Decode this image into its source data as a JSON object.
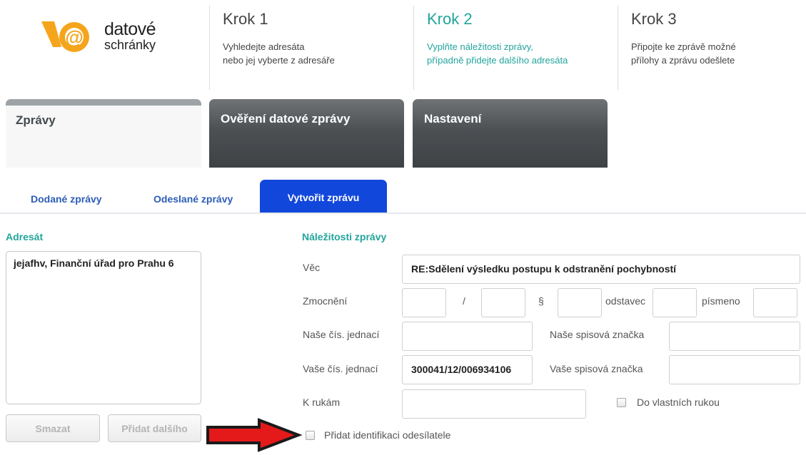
{
  "logo": {
    "line1": "datové",
    "line2": "schránky"
  },
  "steps": [
    {
      "title": "Krok 1",
      "line1": "Vyhledejte adresáta",
      "line2": "nebo jej vyberte z adresáře"
    },
    {
      "title": "Krok 2",
      "line1": "Vyplňte náležitosti zprávy,",
      "line2": "případně přidejte dalšího adresáta"
    },
    {
      "title": "Krok 3",
      "line1": "Připojte ke zprávě možné",
      "line2": "přílohy a zprávu odešlete"
    }
  ],
  "main_tabs": {
    "messages": "Zprávy",
    "verify": "Ověření datové zprávy",
    "settings": "Nastavení"
  },
  "sub_tabs": {
    "delivered": "Dodané zprávy",
    "sent": "Odeslané zprávy",
    "create": "Vytvořit zprávu"
  },
  "recipient": {
    "title": "Adresát",
    "value": "jejafhv, Finanční úřad pro Prahu 6",
    "delete_button": "Smazat",
    "add_button": "Přidat dalšího"
  },
  "form": {
    "title": "Náležitosti zprávy",
    "subject_label": "Věc",
    "subject_value": "RE:Sdělení výsledku postupu k odstranění pochybností",
    "authorization_label": "Zmocnění",
    "slash": "/",
    "section_sign": "§",
    "paragraph_label": "odstavec",
    "letter_label": "písmeno",
    "our_ref_label": "Naše čís. jednací",
    "our_file_label": "Naše spisová značka",
    "your_ref_label": "Vaše čís. jednací",
    "your_ref_value": "300041/12/006934106",
    "your_file_label": "Vaše spisová značka",
    "attention_label": "K rukám",
    "personal_delivery_label": "Do vlastních rukou",
    "add_sender_id_label": "Přidat identifikaci odesílatele"
  },
  "colors": {
    "accent": "#22a49c",
    "active_tab": "#1247dc",
    "arrow": "#e41a1a"
  }
}
